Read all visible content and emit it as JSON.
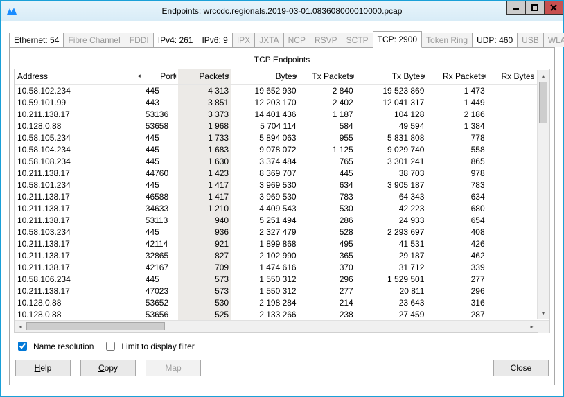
{
  "window": {
    "title": "Endpoints: wrccdc.regionals.2019-03-01.083608000010000.pcap"
  },
  "tabs": [
    {
      "label": "Ethernet: 54",
      "state": "enabled"
    },
    {
      "label": "Fibre Channel",
      "state": "disabled"
    },
    {
      "label": "FDDI",
      "state": "disabled"
    },
    {
      "label": "IPv4: 261",
      "state": "enabled"
    },
    {
      "label": "IPv6: 9",
      "state": "enabled"
    },
    {
      "label": "IPX",
      "state": "disabled"
    },
    {
      "label": "JXTA",
      "state": "disabled"
    },
    {
      "label": "NCP",
      "state": "disabled"
    },
    {
      "label": "RSVP",
      "state": "disabled"
    },
    {
      "label": "SCTP",
      "state": "disabled"
    },
    {
      "label": "TCP: 2900",
      "state": "active"
    },
    {
      "label": "Token Ring",
      "state": "disabled"
    },
    {
      "label": "UDP: 460",
      "state": "enabled"
    },
    {
      "label": "USB",
      "state": "disabled"
    },
    {
      "label": "WLAN",
      "state": "disabled"
    }
  ],
  "panel_title": "TCP Endpoints",
  "columns": {
    "address": "Address",
    "port": "Port",
    "packets": "Packets",
    "bytes": "Bytes",
    "txpackets": "Tx Packets",
    "txbytes": "Tx Bytes",
    "rxpackets": "Rx Packets",
    "rxbytes": "Rx Bytes"
  },
  "sort_column": "packets",
  "sort_dir": "desc",
  "rows": [
    {
      "address": "10.58.102.234",
      "port": "445",
      "packets": "4 313",
      "bytes": "19 652 930",
      "txp": "2 840",
      "txb": "19 523 869",
      "rxp": "1 473",
      "rxb": ""
    },
    {
      "address": "10.59.101.99",
      "port": "443",
      "packets": "3 851",
      "bytes": "12 203 170",
      "txp": "2 402",
      "txb": "12 041 317",
      "rxp": "1 449",
      "rxb": ""
    },
    {
      "address": "10.211.138.17",
      "port": "53136",
      "packets": "3 373",
      "bytes": "14 401 436",
      "txp": "1 187",
      "txb": "104 128",
      "rxp": "2 186",
      "rxb": ""
    },
    {
      "address": "10.128.0.88",
      "port": "53658",
      "packets": "1 968",
      "bytes": "5 704 114",
      "txp": "584",
      "txb": "49 594",
      "rxp": "1 384",
      "rxb": ""
    },
    {
      "address": "10.58.105.234",
      "port": "445",
      "packets": "1 733",
      "bytes": "5 894 063",
      "txp": "955",
      "txb": "5 831 808",
      "rxp": "778",
      "rxb": ""
    },
    {
      "address": "10.58.104.234",
      "port": "445",
      "packets": "1 683",
      "bytes": "9 078 072",
      "txp": "1 125",
      "txb": "9 029 740",
      "rxp": "558",
      "rxb": ""
    },
    {
      "address": "10.58.108.234",
      "port": "445",
      "packets": "1 630",
      "bytes": "3 374 484",
      "txp": "765",
      "txb": "3 301 241",
      "rxp": "865",
      "rxb": ""
    },
    {
      "address": "10.211.138.17",
      "port": "44760",
      "packets": "1 423",
      "bytes": "8 369 707",
      "txp": "445",
      "txb": "38 703",
      "rxp": "978",
      "rxb": ""
    },
    {
      "address": "10.58.101.234",
      "port": "445",
      "packets": "1 417",
      "bytes": "3 969 530",
      "txp": "634",
      "txb": "3 905 187",
      "rxp": "783",
      "rxb": ""
    },
    {
      "address": "10.211.138.17",
      "port": "46588",
      "packets": "1 417",
      "bytes": "3 969 530",
      "txp": "783",
      "txb": "64 343",
      "rxp": "634",
      "rxb": ""
    },
    {
      "address": "10.211.138.17",
      "port": "34633",
      "packets": "1 210",
      "bytes": "4 409 543",
      "txp": "530",
      "txb": "42 223",
      "rxp": "680",
      "rxb": ""
    },
    {
      "address": "10.211.138.17",
      "port": "53113",
      "packets": "940",
      "bytes": "5 251 494",
      "txp": "286",
      "txb": "24 933",
      "rxp": "654",
      "rxb": ""
    },
    {
      "address": "10.58.103.234",
      "port": "445",
      "packets": "936",
      "bytes": "2 327 479",
      "txp": "528",
      "txb": "2 293 697",
      "rxp": "408",
      "rxb": ""
    },
    {
      "address": "10.211.138.17",
      "port": "42114",
      "packets": "921",
      "bytes": "1 899 868",
      "txp": "495",
      "txb": "41 531",
      "rxp": "426",
      "rxb": ""
    },
    {
      "address": "10.211.138.17",
      "port": "32865",
      "packets": "827",
      "bytes": "2 102 990",
      "txp": "365",
      "txb": "29 187",
      "rxp": "462",
      "rxb": ""
    },
    {
      "address": "10.211.138.17",
      "port": "42167",
      "packets": "709",
      "bytes": "1 474 616",
      "txp": "370",
      "txb": "31 712",
      "rxp": "339",
      "rxb": ""
    },
    {
      "address": "10.58.106.234",
      "port": "445",
      "packets": "573",
      "bytes": "1 550 312",
      "txp": "296",
      "txb": "1 529 501",
      "rxp": "277",
      "rxb": ""
    },
    {
      "address": "10.211.138.17",
      "port": "47023",
      "packets": "573",
      "bytes": "1 550 312",
      "txp": "277",
      "txb": "20 811",
      "rxp": "296",
      "rxb": ""
    },
    {
      "address": "10.128.0.88",
      "port": "53652",
      "packets": "530",
      "bytes": "2 198 284",
      "txp": "214",
      "txb": "23 643",
      "rxp": "316",
      "rxb": ""
    },
    {
      "address": "10.128.0.88",
      "port": "53656",
      "packets": "525",
      "bytes": "2 133 266",
      "txp": "238",
      "txb": "27 459",
      "rxp": "287",
      "rxb": ""
    }
  ],
  "options": {
    "name_resolution_label": "Name resolution",
    "name_resolution_checked": true,
    "limit_filter_label": "Limit to display filter",
    "limit_filter_checked": false
  },
  "buttons": {
    "help": "Help",
    "copy": "Copy",
    "map": "Map",
    "close": "Close"
  }
}
